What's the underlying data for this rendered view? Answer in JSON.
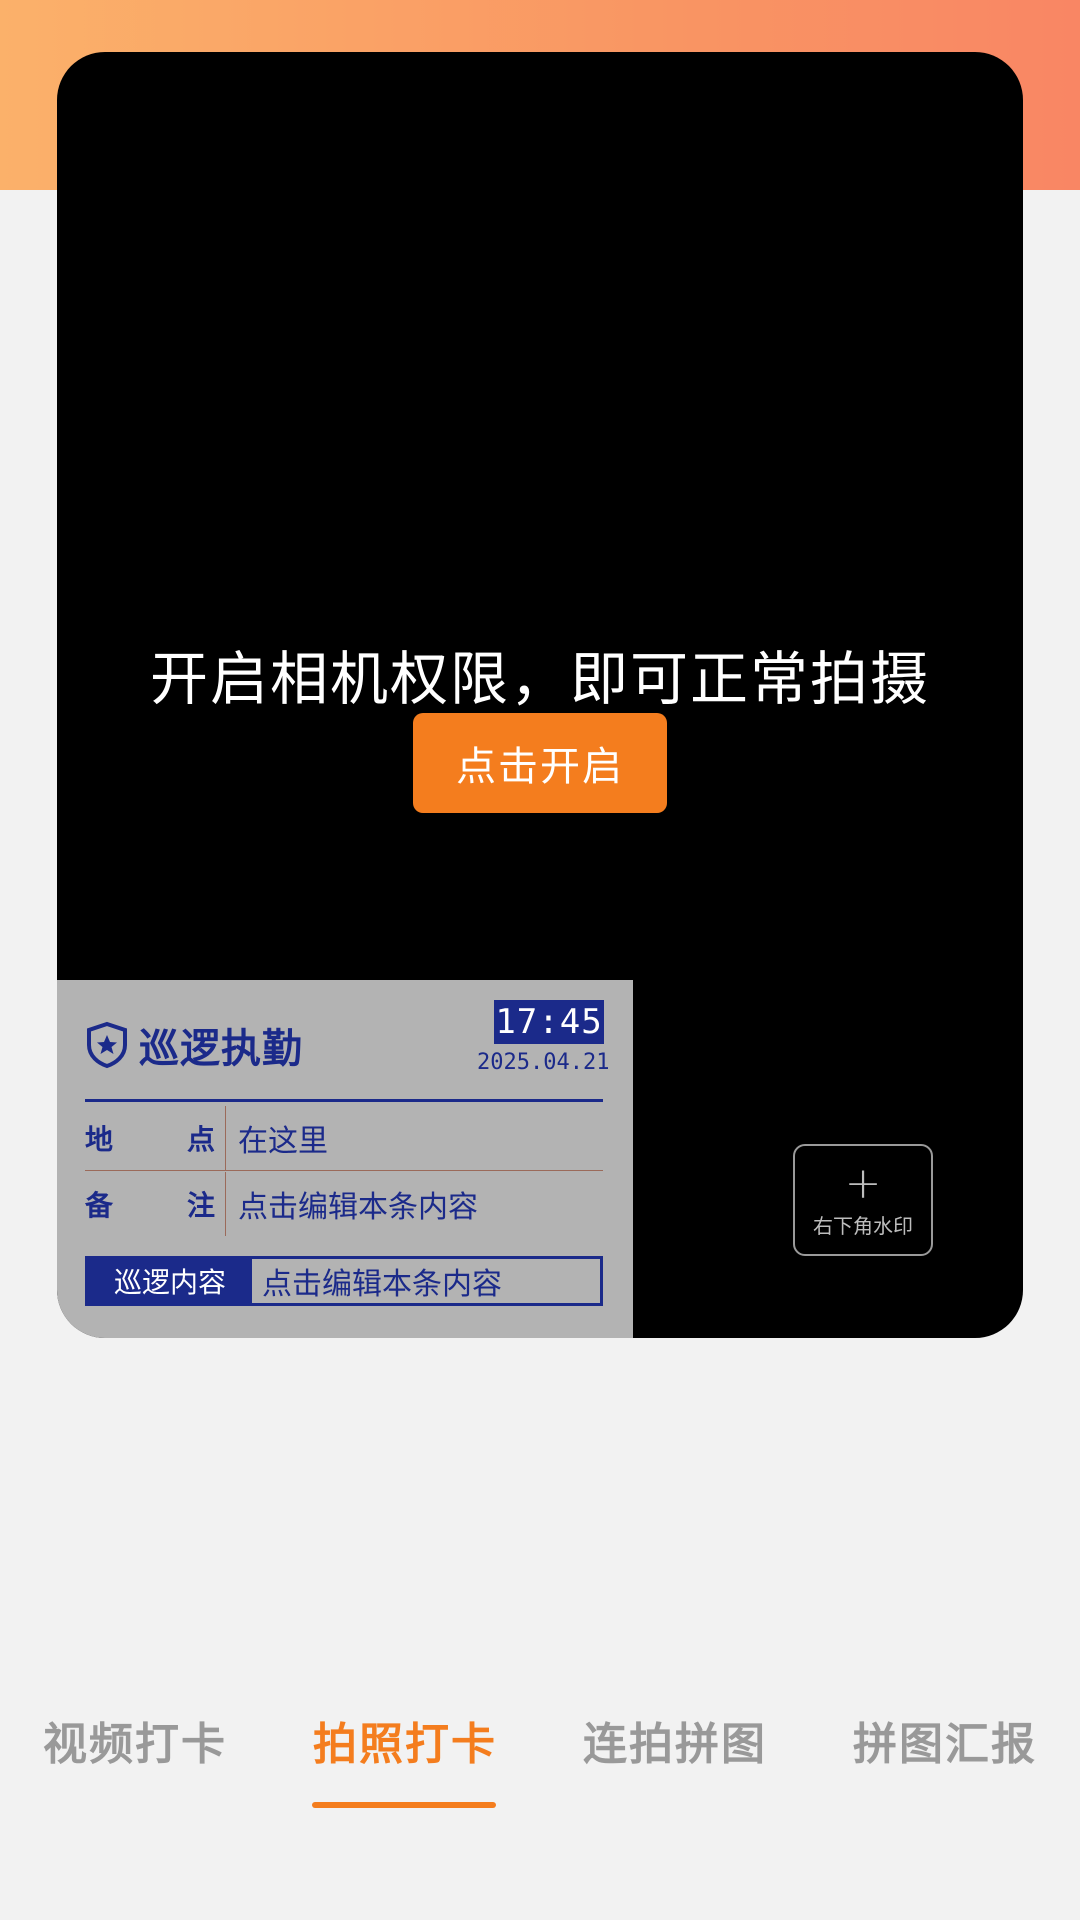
{
  "camera": {
    "permission_text": "开启相机权限，即可正常拍摄",
    "enable_button_label": "点击开启"
  },
  "watermark": {
    "title": "巡逻执勤",
    "time": "17:45",
    "date": "2025.04.21",
    "rows": [
      {
        "key_a": "地",
        "key_b": "点",
        "value": "在这里"
      },
      {
        "key_a": "备",
        "key_b": "注",
        "value": "点击编辑本条内容"
      }
    ],
    "content_label": "巡逻内容",
    "content_value": "点击编辑本条内容",
    "icon": "shield-star-icon"
  },
  "add_watermark": {
    "icon": "plus-icon",
    "label": "右下角水印"
  },
  "tabs": [
    {
      "label": "视频打卡",
      "active": false
    },
    {
      "label": "拍照打卡",
      "active": true
    },
    {
      "label": "连拍拼图",
      "active": false
    },
    {
      "label": "拼图汇报",
      "active": false
    }
  ],
  "colors": {
    "accent": "#f47d1e",
    "watermark_blue": "#1b2a8a",
    "banner_start": "#fbb16a",
    "banner_end": "#f98664"
  }
}
